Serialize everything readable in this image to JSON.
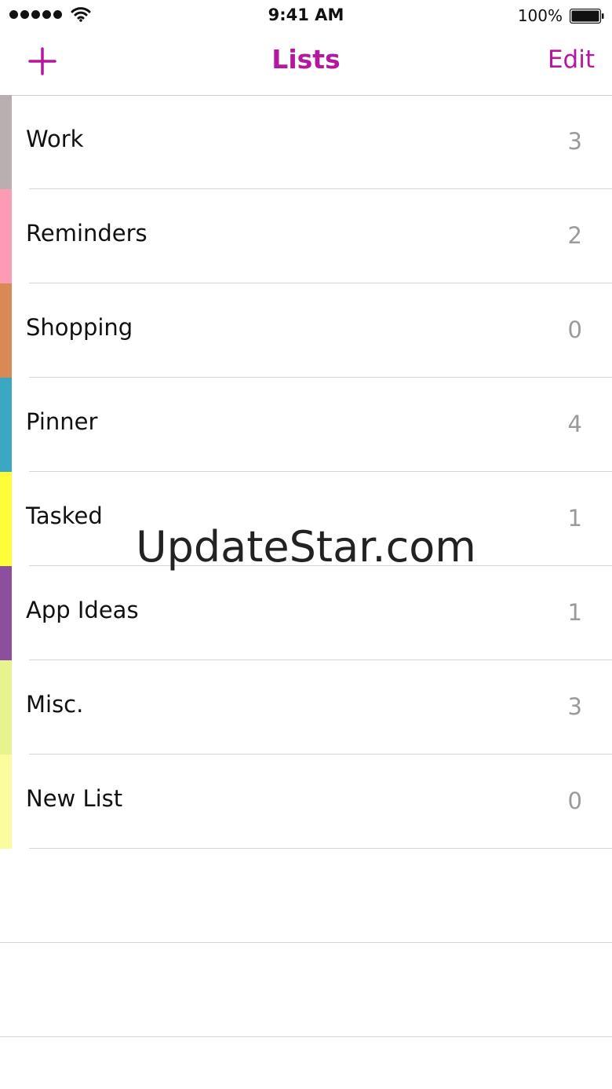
{
  "status_bar": {
    "time": "9:41 AM",
    "battery": "100%",
    "signal_icon": "signal-dots-icon",
    "wifi_icon": "wifi-icon",
    "battery_icon": "battery-icon"
  },
  "nav": {
    "title": "Lists",
    "edit_label": "Edit",
    "add_icon": "plus-icon",
    "accent_color": "#b5179e"
  },
  "lists": [
    {
      "name": "Work",
      "count": "3",
      "color": "#b9aeb0"
    },
    {
      "name": "Reminders",
      "count": "2",
      "color": "#fd9bb2"
    },
    {
      "name": "Shopping",
      "count": "0",
      "color": "#d98a54"
    },
    {
      "name": "Pinner",
      "count": "4",
      "color": "#3aa8c3"
    },
    {
      "name": "Tasked",
      "count": "1",
      "color": "#fffd38"
    },
    {
      "name": "App Ideas",
      "count": "1",
      "color": "#8b4f9e"
    },
    {
      "name": "Misc.",
      "count": "3",
      "color": "#e7f48d"
    },
    {
      "name": "New List",
      "count": "0",
      "color": "#fbfc9d"
    }
  ],
  "watermark": "UpdateStar.com"
}
